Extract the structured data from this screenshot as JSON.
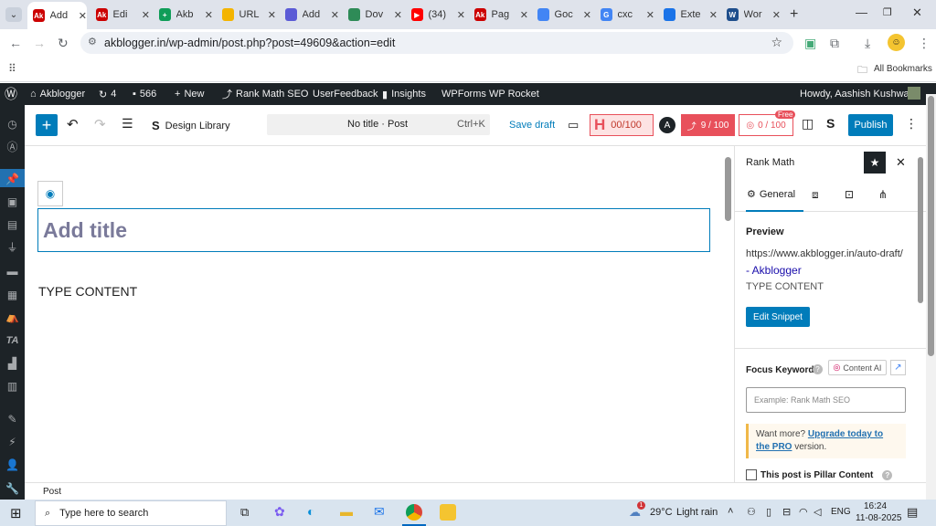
{
  "browser": {
    "tabs": [
      {
        "label": "Add",
        "icon_text": "Ak",
        "color": "#c00"
      },
      {
        "label": "Edi",
        "icon_text": "Ak",
        "color": "#c00"
      },
      {
        "label": "Akb",
        "icon_text": "+",
        "color": "#0f9d58"
      },
      {
        "label": "URL",
        "icon_text": "",
        "color": "#f4b400"
      },
      {
        "label": "Add",
        "icon_text": "",
        "color": "#5b5bd6"
      },
      {
        "label": "Dov",
        "icon_text": "",
        "color": "#2e8b57"
      },
      {
        "label": "(34)",
        "icon_text": "▶",
        "color": "#f00"
      },
      {
        "label": "Pag",
        "icon_text": "Ak",
        "color": "#c00"
      },
      {
        "label": "Goc",
        "icon_text": "",
        "color": "#4285f4"
      },
      {
        "label": "cxc",
        "icon_text": "G",
        "color": "#4285f4"
      },
      {
        "label": "Exte",
        "icon_text": "",
        "color": "#1a73e8"
      },
      {
        "label": "Wor",
        "icon_text": "W",
        "color": "#1e4e8c"
      }
    ],
    "url": "akblogger.in/wp-admin/post.php?post=49609&action=edit",
    "all_bookmarks": "All Bookmarks"
  },
  "adminbar": {
    "site": "Akblogger",
    "updates": "4",
    "comments": "566",
    "new": "New",
    "rankmath": "Rank Math SEO",
    "userfeedback": "UserFeedback",
    "insights": "Insights",
    "wpforms": "WPForms",
    "wprocket": "WP Rocket",
    "howdy": "Howdy, Aashish Kushwaha"
  },
  "editor": {
    "design_library": "Design Library",
    "doc_title": "No title · Post",
    "shortcut": "Ctrl+K",
    "save_draft": "Save draft",
    "headline_score": "00/100",
    "score_9": "9 / 100",
    "score_0": "0 / 100",
    "free_badge": "Free",
    "publish": "Publish",
    "title_placeholder": "Add title",
    "content": "TYPE CONTENT",
    "footer_label": "Post"
  },
  "rankmath": {
    "title": "Rank Math",
    "tab_general": "General",
    "preview_heading": "Preview",
    "preview_url": "https://www.akblogger.in/auto-draft/",
    "preview_title": "- Akblogger",
    "preview_desc": "TYPE CONTENT",
    "edit_snippet": "Edit Snippet",
    "focus_keyword": "Focus Keyword",
    "content_ai": "Content AI",
    "keyword_placeholder": "Example: Rank Math SEO",
    "want_more": "Want more?",
    "upgrade_link": "Upgrade today to the PRO",
    "version": " version.",
    "pillar": "This post is Pillar Content"
  },
  "taskbar": {
    "search_placeholder": "Type here to search",
    "weather_temp": "29°C",
    "weather_desc": "Light rain",
    "lang": "ENG",
    "time": "16:24",
    "date": "11-08-2025",
    "notification_count": "1"
  },
  "colors": {
    "wp_dark": "#1d2327",
    "wp_blue": "#007cba",
    "rank_red": "#e8505b",
    "accent_purple": "#5b5bd6"
  }
}
